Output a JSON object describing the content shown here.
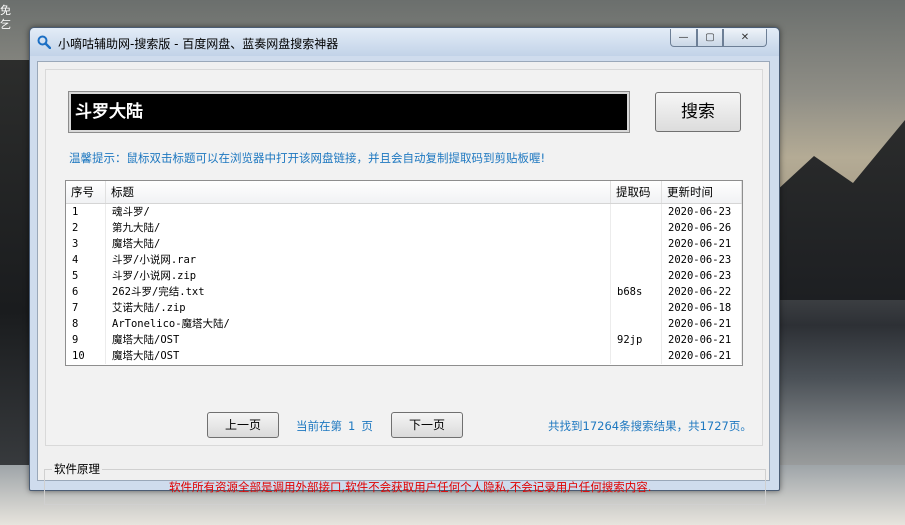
{
  "desktop": {
    "text": "免\n乞"
  },
  "window": {
    "title": "小嘀咕辅助网-搜索版 - 百度网盘、蓝奏网盘搜索神器",
    "controls": {
      "minimize": "—",
      "maximize": "▢",
      "close": "✕"
    }
  },
  "search": {
    "value": "斗罗大陆",
    "button_label": "搜索"
  },
  "tip": "温馨提示：鼠标双击标题可以在浏览器中打开该网盘链接，并且会自动复制提取码到剪贴板喔!",
  "table": {
    "columns": [
      "序号",
      "标题",
      "提取码",
      "更新时间"
    ],
    "rows": [
      {
        "index": "1",
        "title": "魂斗罗/",
        "code": "",
        "date": "2020-06-23"
      },
      {
        "index": "2",
        "title": "第九大陆/",
        "code": "",
        "date": "2020-06-26"
      },
      {
        "index": "3",
        "title": "魔塔大陆/",
        "code": "",
        "date": "2020-06-21"
      },
      {
        "index": "4",
        "title": "斗罗/小说网.rar",
        "code": "",
        "date": "2020-06-23"
      },
      {
        "index": "5",
        "title": "斗罗/小说网.zip",
        "code": "",
        "date": "2020-06-23"
      },
      {
        "index": "6",
        "title": "262斗罗/完结.txt",
        "code": "b68s",
        "date": "2020-06-22"
      },
      {
        "index": "7",
        "title": "艾诺大陆/.zip",
        "code": "",
        "date": "2020-06-18"
      },
      {
        "index": "8",
        "title": "ArTonelico-魔塔大陆/",
        "code": "",
        "date": "2020-06-21"
      },
      {
        "index": "9",
        "title": "魔塔大陆/OST",
        "code": "92jp",
        "date": "2020-06-21"
      },
      {
        "index": "10",
        "title": "魔塔大陆/OST",
        "code": "",
        "date": "2020-06-21"
      }
    ]
  },
  "pagination": {
    "prev_label": "上一页",
    "next_label": "下一页",
    "current_prefix": "当前在第",
    "current_page": "1",
    "current_suffix": "页",
    "result_summary": "共找到17264条搜索结果，共1727页。"
  },
  "principle": {
    "title": "软件原理",
    "notice": "软件所有资源全部是调用外部接口,软件不会获取用户任何个人隐私,不会记录用户任何搜索内容."
  },
  "colors": {
    "accent": "#1e78c0",
    "warning": "#e00000",
    "input_bg": "#000000"
  },
  "icons": {
    "title": "search-icon"
  }
}
